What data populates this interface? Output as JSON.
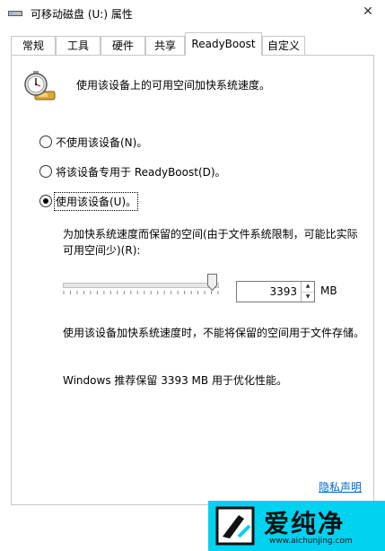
{
  "window": {
    "title": "可移动磁盘 (U:) 属性",
    "close_glyph": "✕"
  },
  "tabs": [
    {
      "label": "常规"
    },
    {
      "label": "工具"
    },
    {
      "label": "硬件"
    },
    {
      "label": "共享"
    },
    {
      "label": "ReadyBoost",
      "active": true
    },
    {
      "label": "自定义"
    }
  ],
  "readyboost": {
    "intro": "使用该设备上的可用空间加快系统速度。",
    "options": [
      {
        "label": "不使用该设备(N)。",
        "checked": false
      },
      {
        "label": "将该设备专用于 ReadyBoost(D)。",
        "checked": false
      },
      {
        "label": "使用该设备(U)。",
        "checked": true
      }
    ],
    "reserve_label": "为加快系统速度而保留的空间(由于文件系统限制，可能比实际可用空间少)(R):",
    "reserve_fraction": 0.97,
    "reserve_value": "3393",
    "unit": "MB",
    "note": "使用该设备加快系统速度时，不能将保留的空间用于文件存储。",
    "recommendation": "Windows 推荐保留 3393 MB 用于优化性能。",
    "privacy_link": "隐私声明"
  },
  "watermark": {
    "title": "爱纯净",
    "url": "www.aichunjing.com"
  },
  "colors": {
    "link": "#0066cc",
    "watermark_bg": "#00d2f0"
  },
  "icons": {
    "title": "removable-drive-icon",
    "readyboost": "readyboost-stopwatch-icon"
  }
}
